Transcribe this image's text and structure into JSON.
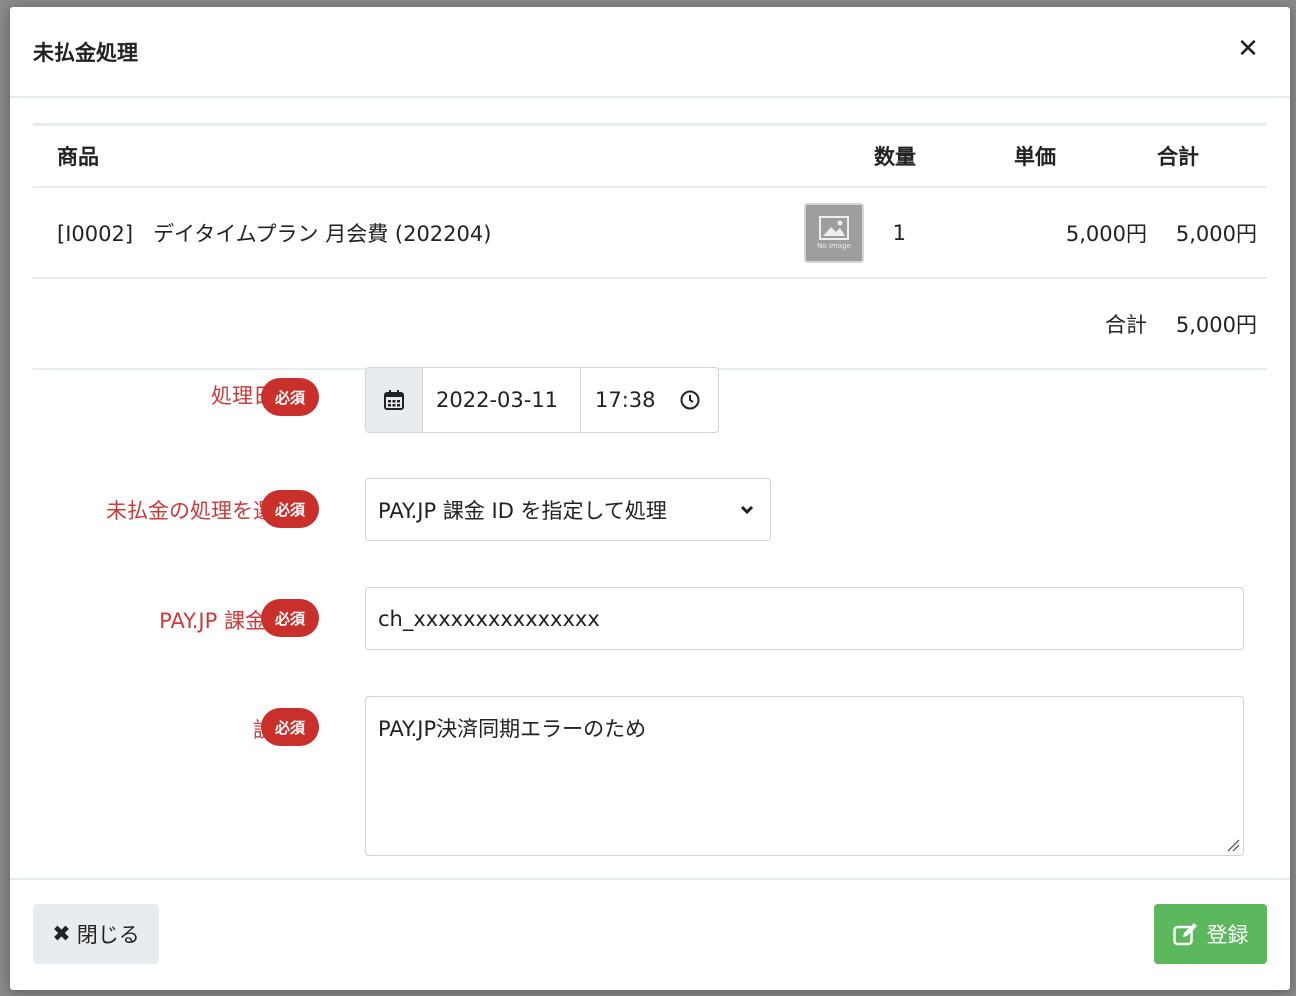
{
  "modal": {
    "title": "未払金処理",
    "close_icon": "close-icon"
  },
  "table": {
    "headers": [
      "商品",
      "数量",
      "単価",
      "合計"
    ],
    "rows": [
      {
        "code": "[I0002]",
        "name": "デイタイムプラン 月会費 (202204)",
        "image_alt": "No Image",
        "quantity": "1",
        "unit_price": "5,000円",
        "total": "5,000円"
      }
    ],
    "total_label": "合計",
    "total_value": "5,000円"
  },
  "form": {
    "required_badge": "必須",
    "datetime": {
      "label": "処理日時",
      "date": "2022-03-11",
      "time": "17:38"
    },
    "method": {
      "label": "未払金の処理を選択",
      "selected": "PAY.JP 課金 ID を指定して処理"
    },
    "charge_id": {
      "label": "PAY.JP 課金 ID",
      "value": "ch_xxxxxxxxxxxxxxx"
    },
    "description": {
      "label": "説明",
      "value": "PAY.JP決済同期エラーのため"
    }
  },
  "footer": {
    "close_label": "閉じる",
    "submit_label": "登録"
  },
  "colors": {
    "required": "#c9302c",
    "label": "#cc3b3b",
    "submit": "#5cb85c"
  }
}
